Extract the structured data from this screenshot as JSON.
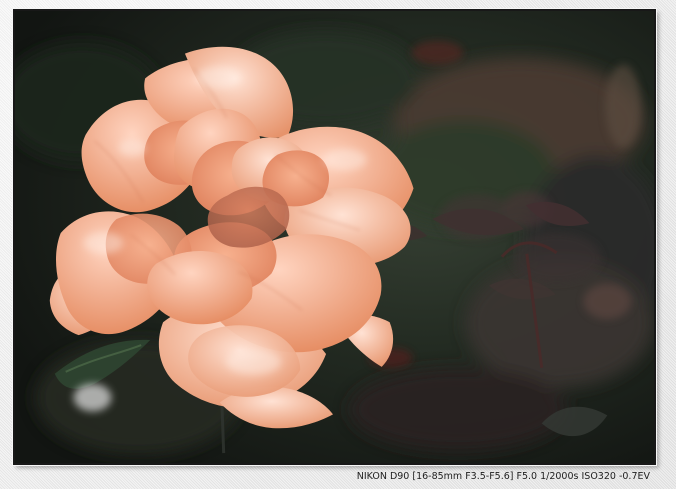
{
  "caption": {
    "camera_info": "NIKON D90 [16-85mm F3.5-F5.6] F5.0 1/2000s ISO320 -0.7EV"
  },
  "colors": {
    "frame_border": "#181818",
    "background_dark": "#1c201b",
    "petal_light": "#f3c4ae",
    "petal_mid": "#ef9f74",
    "petal_deep": "#e7875d"
  }
}
